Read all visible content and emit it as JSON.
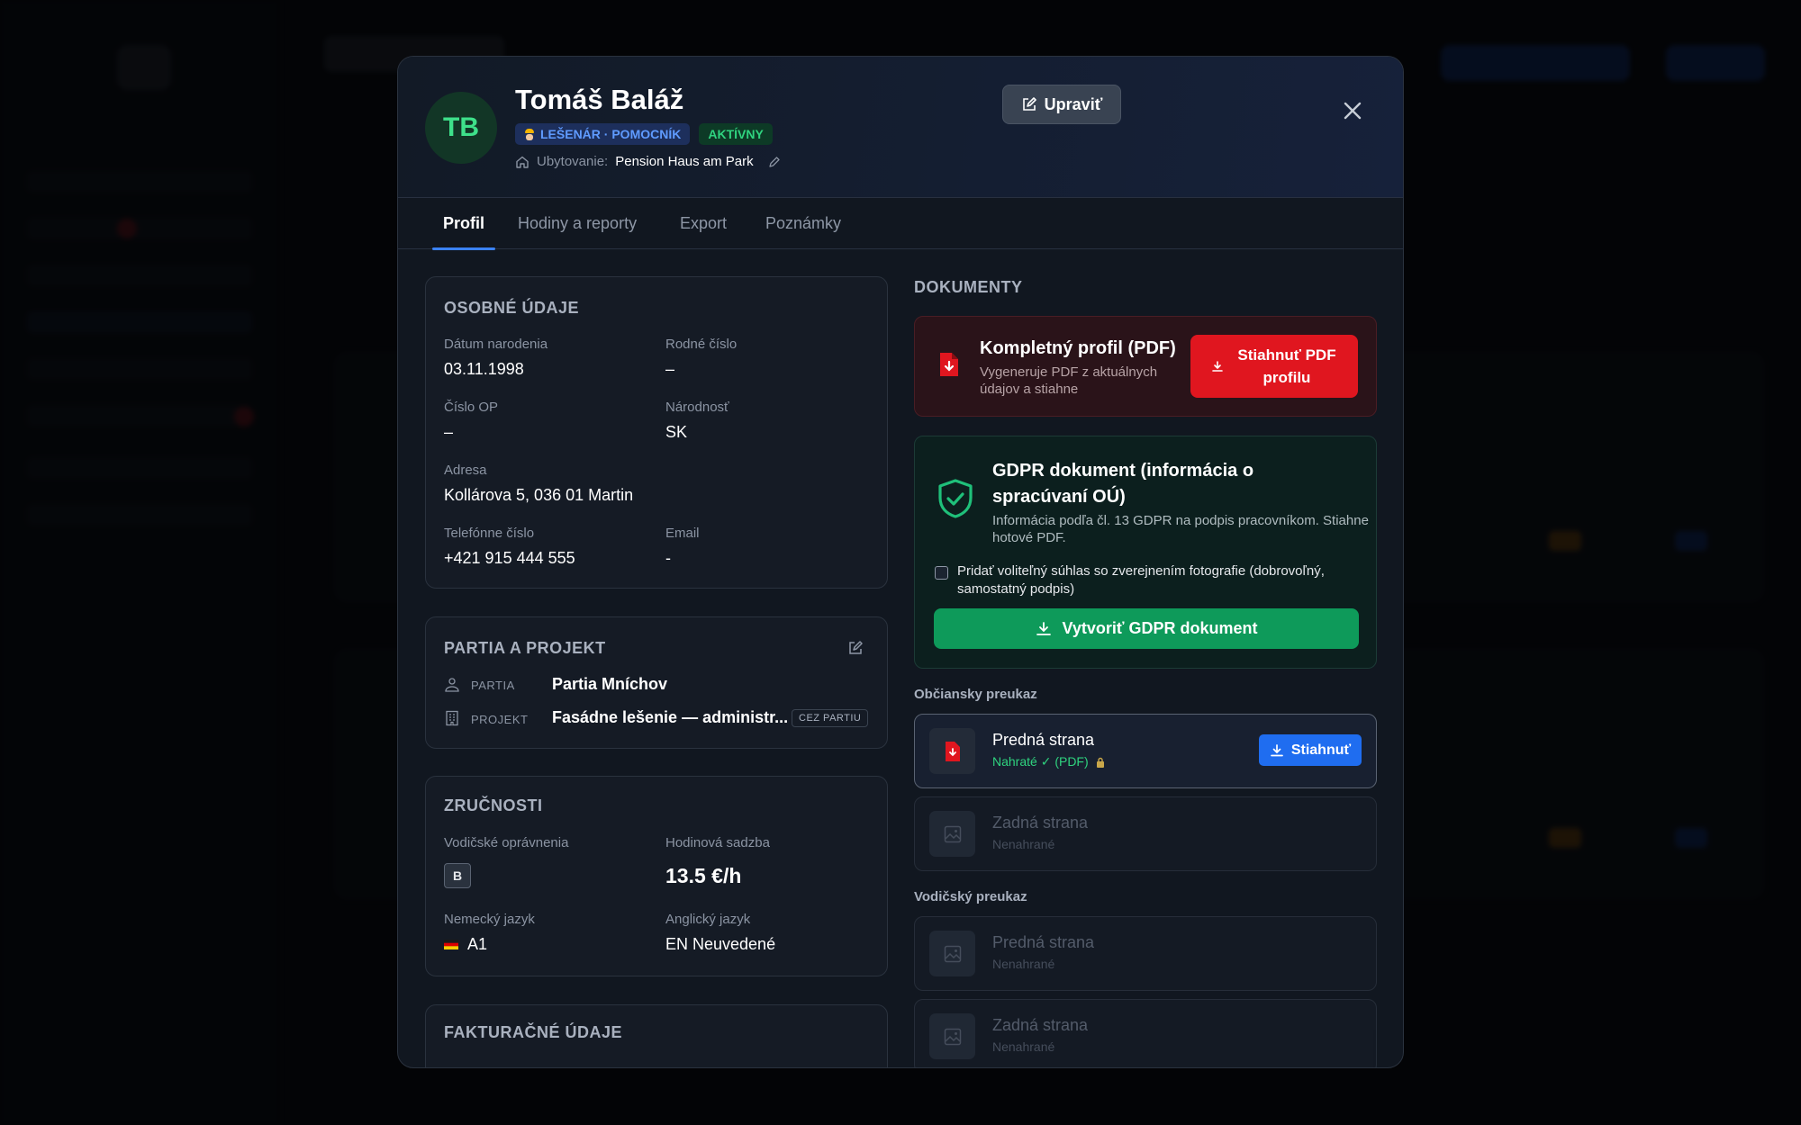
{
  "employee": {
    "initials": "TB",
    "name": "Tomáš Baláž",
    "role_badge": "LEŠENÁR · POMOCNÍK",
    "status_badge": "AKTÍVNY",
    "lodging_label": "Ubytovanie:",
    "lodging_value": "Pension Haus am Park"
  },
  "header": {
    "edit_label": "Upraviť"
  },
  "tabs": [
    {
      "label": "Profil",
      "active": true
    },
    {
      "label": "Hodiny a reporty",
      "active": false
    },
    {
      "label": "Export",
      "active": false
    },
    {
      "label": "Poznámky",
      "active": false
    }
  ],
  "personal": {
    "title": "OSOBNÉ ÚDAJE",
    "birth_date_label": "Dátum narodenia",
    "birth_date": "03.11.1998",
    "birth_number_label": "Rodné číslo",
    "birth_number": "–",
    "id_card_label": "Číslo OP",
    "id_card": "–",
    "nationality_label": "Národnosť",
    "nationality": "SK",
    "address_label": "Adresa",
    "address": "Kollárova 5, 036 01 Martin",
    "phone_label": "Telefónne číslo",
    "phone": "+421 915 444 555",
    "email_label": "Email",
    "email": "-"
  },
  "team": {
    "title": "PARTIA A PROJEKT",
    "team_label": "PARTIA",
    "team_value": "Partia Mníchov",
    "project_label": "PROJEKT",
    "project_value": "Fasádne lešenie — administr...",
    "project_tag": "CEZ PARTIU"
  },
  "skills": {
    "title": "ZRUČNOSTI",
    "license_label": "Vodičské oprávnenia",
    "license_value": "B",
    "rate_label": "Hodinová sadzba",
    "rate_value": "13.5 €/h",
    "german_label": "Nemecký jazyk",
    "german_value": "A1",
    "english_label": "Anglický jazyk",
    "english_value": "EN Neuvedené"
  },
  "billing": {
    "title": "FAKTURAČNÉ ÚDAJE"
  },
  "documents": {
    "title": "DOKUMENTY",
    "pdf_title": "Kompletný profil (PDF)",
    "pdf_sub": "Vygeneruje PDF z aktuálnych údajov a stiahne",
    "pdf_button": "Stiahnuť PDF profilu",
    "gdpr_title": "GDPR dokument (informácia o spracúvaní OÚ)",
    "gdpr_sub": "Informácia podľa čl. 13 GDPR na podpis pracovníkom. Stiahne hotové PDF.",
    "gdpr_checkbox": "Pridať voliteľný súhlas so zverejnením fotografie (dobrovoľný, samostatný podpis)",
    "gdpr_button": "Vytvoriť GDPR dokument",
    "id_section": "Občiansky preukaz",
    "driver_section": "Vodičský preukaz",
    "id_front_title": "Predná strana",
    "id_front_status": "Nahraté ✓ (PDF)",
    "download_label": "Stiahnuť",
    "id_back_title": "Zadná strana",
    "id_back_status": "Nenahrané",
    "dl_front_title": "Predná strana",
    "dl_front_status": "Nenahrané",
    "dl_back_title": "Zadná strana",
    "dl_back_status": "Nenahrané"
  },
  "colors": {
    "accent": "#3b82f6",
    "success": "#2fd37f",
    "danger": "#e0161f",
    "gdpr_button": "#0e9a5a"
  }
}
